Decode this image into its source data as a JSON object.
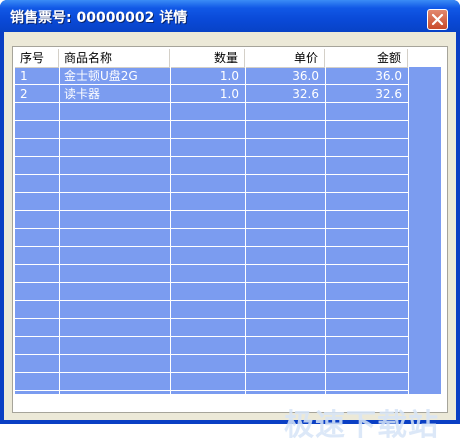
{
  "window": {
    "title": "销售票号: 00000002 详情",
    "close_icon": "close-icon"
  },
  "table": {
    "columns": [
      "序号",
      "商品名称",
      "数量",
      "单价",
      "金额"
    ],
    "rows": [
      {
        "no": "1",
        "name": "金士顿U盘2G",
        "qty": "1.0",
        "price": "36.0",
        "amount": "36.0"
      },
      {
        "no": "2",
        "name": "读卡器",
        "qty": "1.0",
        "price": "32.6",
        "amount": "32.6"
      }
    ]
  },
  "watermark": "极速下载站",
  "colors": {
    "titlebar": "#0a4ad8",
    "grid_background": "#7b9cf0",
    "dialog_background": "#ece9d8",
    "close_button": "#c94a2a"
  }
}
